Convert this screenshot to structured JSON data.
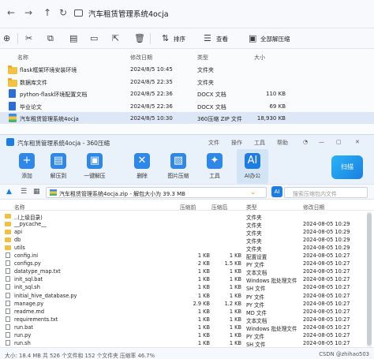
{
  "explorer": {
    "path": "汽车租赁管理系统4ocja",
    "toolbar": {
      "sort": "排序",
      "view": "查看",
      "extract_all": "全部解压缩"
    },
    "columns": {
      "name": "名称",
      "date": "修改日期",
      "type": "类型",
      "size": "大小"
    },
    "rows": [
      {
        "name": "flask框架环境安装环境",
        "date": "2024/8/5 10:45",
        "type": "文件夹",
        "size": "",
        "kind": "folder"
      },
      {
        "name": "数据库文件",
        "date": "2024/8/5 22:35",
        "type": "文件夹",
        "size": "",
        "kind": "folder"
      },
      {
        "name": "python-flask环境配置文档",
        "date": "2024/8/5 22:36",
        "type": "DOCX 文档",
        "size": "110 KB",
        "kind": "doc"
      },
      {
        "name": "毕业论文",
        "date": "2024/8/5 22:36",
        "type": "DOCX 文档",
        "size": "69 KB",
        "kind": "doc"
      },
      {
        "name": "汽车租赁管理系统4ocja",
        "date": "2024/8/5 10:30",
        "type": "360压缩 ZIP 文件",
        "size": "18,930 KB",
        "kind": "zip"
      }
    ]
  },
  "zip": {
    "title": "汽车租赁管理系统4ocja - 360压缩",
    "menu": [
      "文件",
      "操作",
      "工具",
      "帮助"
    ],
    "tools": [
      {
        "label": "添加",
        "icon": "add-icon",
        "color": "#2f88e8"
      },
      {
        "label": "解压到",
        "icon": "extract-icon",
        "color": "#2f88e8"
      },
      {
        "label": "一键解压",
        "icon": "one-click-extract-icon",
        "color": "#2f88e8"
      },
      {
        "label": "删除",
        "icon": "delete-icon",
        "color": "#2f88e8"
      },
      {
        "label": "图片压缩",
        "icon": "image-compress-icon",
        "color": "#2f88e8"
      },
      {
        "label": "工具",
        "icon": "tools-icon",
        "color": "#2f88e8"
      },
      {
        "label": "AI办公",
        "icon": "ai-icon",
        "color": "#1d7de0"
      }
    ],
    "scan_label": "扫描",
    "address": "汽车租赁管理系统4ocja.zip - 解包大小为 39.3 MB",
    "search_placeholder": "搜索压缩包内文件",
    "columns": {
      "name": "名称",
      "compressed": "压缩前",
      "after": "压缩后",
      "type": "类型",
      "modified": "修改日期"
    },
    "rows": [
      {
        "name": "..(上级目录)",
        "c": "",
        "a": "",
        "t": "文件夹",
        "m": "",
        "kind": "up"
      },
      {
        "name": "__pycache__",
        "c": "",
        "a": "",
        "t": "文件夹",
        "m": "2024-08-05 10:29",
        "kind": "folder"
      },
      {
        "name": "api",
        "c": "",
        "a": "",
        "t": "文件夹",
        "m": "2024-08-05 10:29",
        "kind": "folder"
      },
      {
        "name": "db",
        "c": "",
        "a": "",
        "t": "文件夹",
        "m": "2024-08-05 10:29",
        "kind": "folder"
      },
      {
        "name": "utils",
        "c": "",
        "a": "",
        "t": "文件夹",
        "m": "2024-08-05 10:29",
        "kind": "folder"
      },
      {
        "name": "config.ini",
        "c": "1 KB",
        "a": "1 KB",
        "t": "配置设置",
        "m": "2024-08-05 10:27",
        "kind": "file"
      },
      {
        "name": "configs.py",
        "c": "2 KB",
        "a": "1.5 KB",
        "t": "PY 文件",
        "m": "2024-08-05 10:27",
        "kind": "file"
      },
      {
        "name": "datatype_map.txt",
        "c": "1 KB",
        "a": "1 KB",
        "t": "文本文档",
        "m": "2024-08-05 10:27",
        "kind": "file"
      },
      {
        "name": "init_sql.bat",
        "c": "1 KB",
        "a": "1 KB",
        "t": "Windows 批处理文件",
        "m": "2024-08-05 10:27",
        "kind": "file"
      },
      {
        "name": "init_sql.sh",
        "c": "1 KB",
        "a": "1 KB",
        "t": "SH 文件",
        "m": "2024-08-05 10:27",
        "kind": "file"
      },
      {
        "name": "initial_hive_database.py",
        "c": "1 KB",
        "a": "1 KB",
        "t": "PY 文件",
        "m": "2024-08-05 10:27",
        "kind": "file"
      },
      {
        "name": "manage.py",
        "c": "2.9 KB",
        "a": "1.2 KB",
        "t": "PY 文件",
        "m": "2024-08-05 10:27",
        "kind": "file"
      },
      {
        "name": "readme.md",
        "c": "1 KB",
        "a": "1 KB",
        "t": "MD 文件",
        "m": "2024-08-05 10:27",
        "kind": "file"
      },
      {
        "name": "requirements.txt",
        "c": "1 KB",
        "a": "1 KB",
        "t": "文本文档",
        "m": "2024-08-05 10:27",
        "kind": "file"
      },
      {
        "name": "run.bat",
        "c": "1 KB",
        "a": "1 KB",
        "t": "Windows 批处理文件",
        "m": "2024-08-05 10:27",
        "kind": "file"
      },
      {
        "name": "run.py",
        "c": "1 KB",
        "a": "1 KB",
        "t": "PY 文件",
        "m": "2024-08-05 10:27",
        "kind": "file"
      },
      {
        "name": "run.sh",
        "c": "1 KB",
        "a": "1 KB",
        "t": "SH 文件",
        "m": "2024-08-05 10:27",
        "kind": "file"
      }
    ],
    "status": "大小: 18.4 MB 共 526 个文件和 152 个文件夹 压缩率 46.7%",
    "watermark": "CSDN @zhihao503"
  }
}
